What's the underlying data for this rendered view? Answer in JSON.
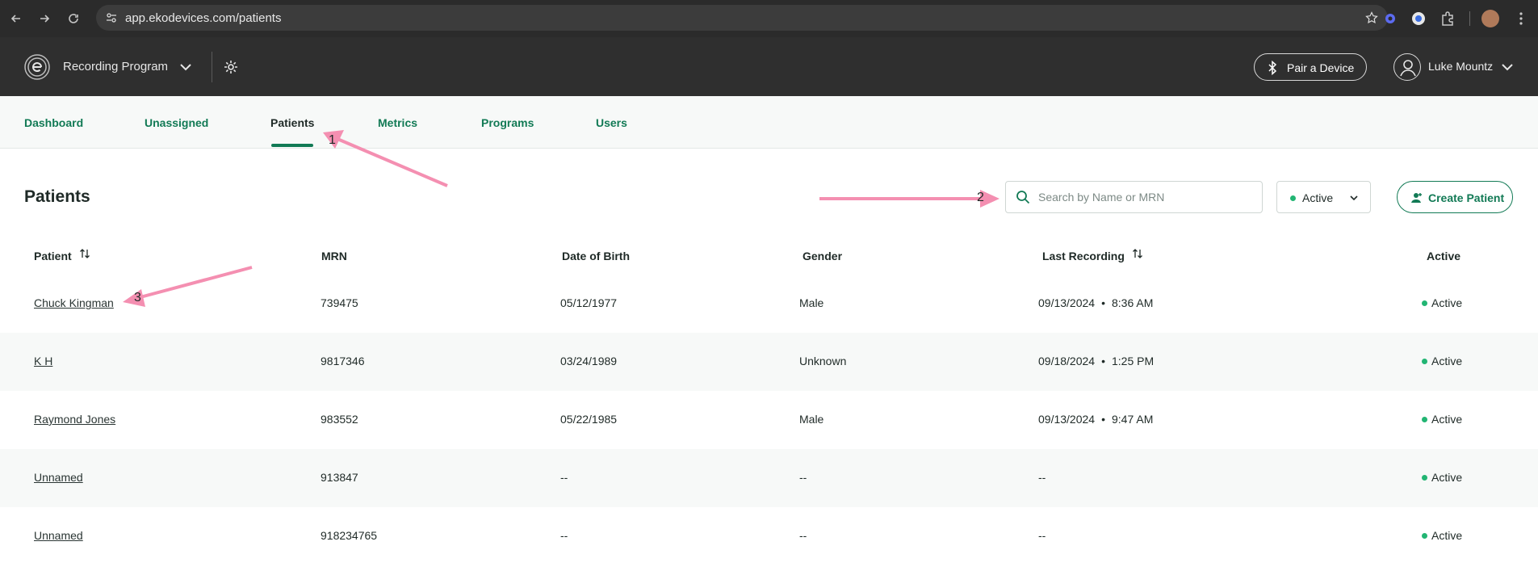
{
  "browser": {
    "url": "app.ekodevices.com/patients"
  },
  "header": {
    "program_name": "Recording Program",
    "pair_button": "Pair a Device",
    "user_name": "Luke Mountz"
  },
  "tabs": [
    {
      "label": "Dashboard"
    },
    {
      "label": "Unassigned"
    },
    {
      "label": "Patients"
    },
    {
      "label": "Metrics"
    },
    {
      "label": "Programs"
    },
    {
      "label": "Users"
    }
  ],
  "page": {
    "title": "Patients",
    "search_placeholder": "Search by Name or MRN",
    "status_filter": "Active",
    "create_button": "Create Patient"
  },
  "table": {
    "columns": [
      "Patient",
      "MRN",
      "Date of Birth",
      "Gender",
      "Last Recording",
      "Active"
    ],
    "rows": [
      {
        "patient": "Chuck Kingman",
        "mrn": "739475",
        "dob": "05/12/1977",
        "gender": "Male",
        "rec_date": "09/13/2024",
        "rec_sep": "•",
        "rec_time": "8:36 AM",
        "active": "Active"
      },
      {
        "patient": "K H",
        "mrn": "9817346",
        "dob": "03/24/1989",
        "gender": "Unknown",
        "rec_date": "09/18/2024",
        "rec_sep": "•",
        "rec_time": "1:25 PM",
        "active": "Active"
      },
      {
        "patient": "Raymond Jones",
        "mrn": "983552",
        "dob": "05/22/1985",
        "gender": "Male",
        "rec_date": "09/13/2024",
        "rec_sep": "•",
        "rec_time": "9:47 AM",
        "active": "Active"
      },
      {
        "patient": "Unnamed",
        "mrn": "913847",
        "dob": "--",
        "gender": "--",
        "rec_date": "--",
        "rec_sep": "",
        "rec_time": "",
        "active": "Active"
      },
      {
        "patient": "Unnamed",
        "mrn": "918234765",
        "dob": "--",
        "gender": "--",
        "rec_date": "--",
        "rec_sep": "",
        "rec_time": "",
        "active": "Active"
      }
    ]
  },
  "annotations": {
    "labels": [
      "1",
      "2",
      "3"
    ],
    "color": "#f48fb1"
  },
  "colors": {
    "brand_green": "#127a55",
    "status_green": "#22b573",
    "header_bg": "#2f2f2f"
  }
}
